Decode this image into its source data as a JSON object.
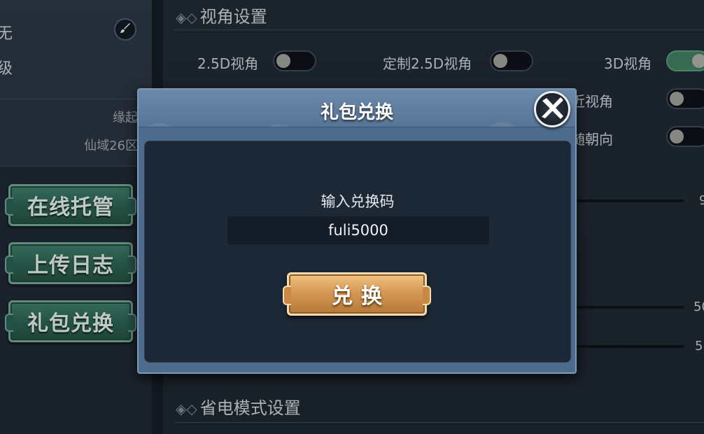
{
  "left_panel": {
    "profile_line1": "无",
    "profile_line2": "级",
    "tagline": "缘起",
    "server": "仙域26区",
    "buttons": [
      "在线托管",
      "上传日志",
      "礼包兑换"
    ]
  },
  "settings": {
    "camera_section_title": "视角设置",
    "power_section_title": "省电模式设置",
    "options": [
      {
        "label": "2.5D视角",
        "on": false
      },
      {
        "label": "定制2.5D视角",
        "on": false
      },
      {
        "label": "3D视角",
        "on": true
      },
      {
        "label": "拉近视角",
        "on": false
      },
      {
        "label": "跟随朝向",
        "on": false
      }
    ],
    "slider_values": [
      "9",
      "50",
      "5"
    ]
  },
  "dialog": {
    "title": "礼包兑换",
    "prompt": "输入兑换码",
    "code_value": "fuli5000",
    "redeem_label": "兑换"
  },
  "colors": {
    "dialog_header": "#5f7ea0",
    "dialog_body": "#1c2835",
    "jade_button": "#2f6656",
    "gold_button": "#d69a55",
    "toggle_on": "#3e7a5e"
  }
}
